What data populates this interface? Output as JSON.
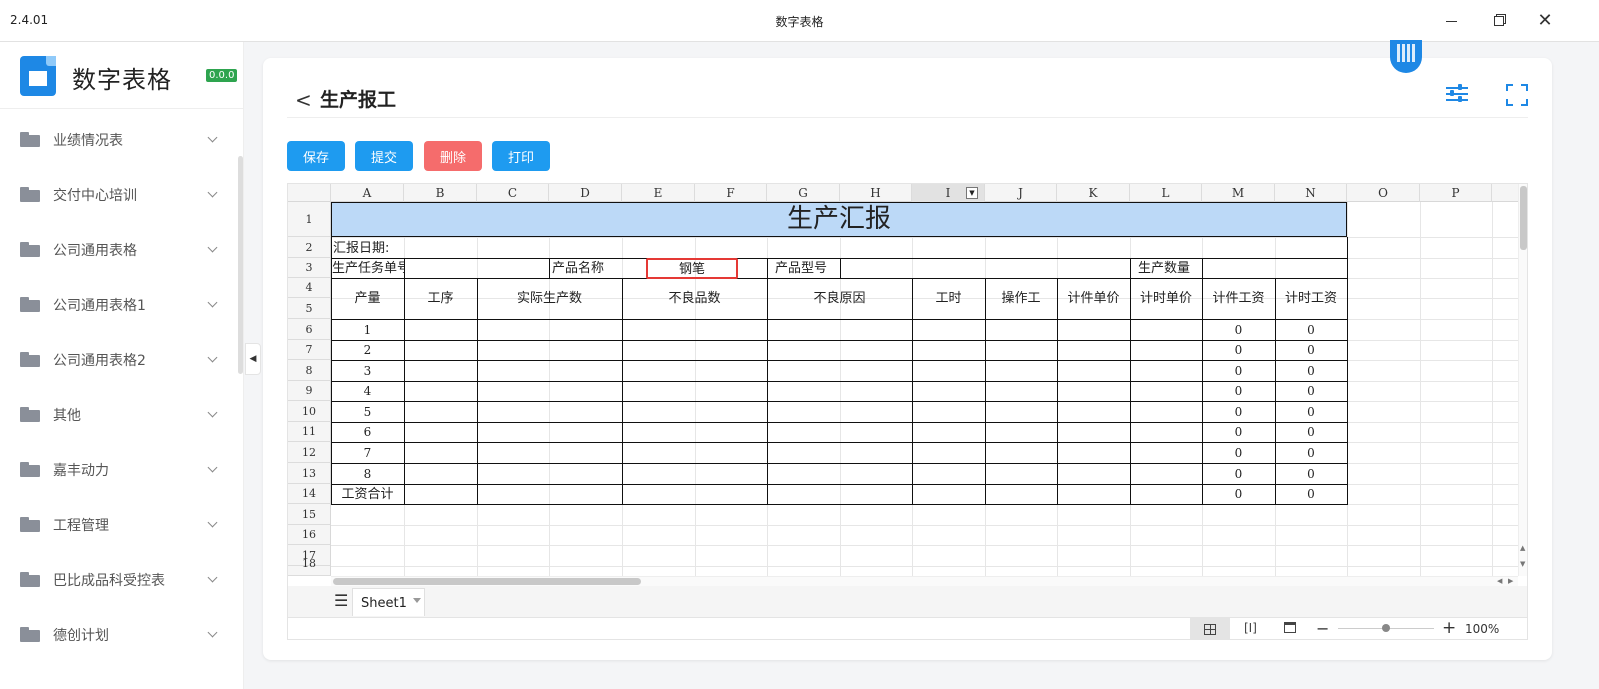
{
  "window": {
    "version": "2.4.01",
    "title": "数字表格"
  },
  "sidebar": {
    "app_name": "数字表格",
    "version_badge": "0.0.0",
    "items": [
      {
        "label": "业绩情况表"
      },
      {
        "label": "交付中心培训"
      },
      {
        "label": "公司通用表格"
      },
      {
        "label": "公司通用表格1"
      },
      {
        "label": "公司通用表格2"
      },
      {
        "label": "其他"
      },
      {
        "label": "嘉丰动力"
      },
      {
        "label": "工程管理"
      },
      {
        "label": "巴比成品科受控表"
      },
      {
        "label": "德创计划"
      }
    ]
  },
  "page": {
    "title": "生产报工",
    "back_symbol": "<"
  },
  "toolbar": {
    "save": "保存",
    "submit": "提交",
    "delete": "删除",
    "print": "打印",
    "colors": {
      "primary": "#1e9bf0",
      "danger": "#f56c6c"
    }
  },
  "spreadsheet": {
    "columns": [
      "A",
      "B",
      "C",
      "D",
      "E",
      "F",
      "G",
      "H",
      "I",
      "J",
      "K",
      "L",
      "M",
      "N",
      "O",
      "P"
    ],
    "rows": [
      "1",
      "2",
      "3",
      "4",
      "5",
      "6",
      "7",
      "8",
      "9",
      "10",
      "11",
      "12",
      "13",
      "14",
      "15",
      "16",
      "17",
      "18"
    ],
    "title": "生产汇报",
    "report_date_label": "汇报日期:",
    "task_no_label": "生产任务单号",
    "product_name_label": "产品名称",
    "product_name_value": "钢笔",
    "product_model_label": "产品型号",
    "production_qty_label": "生产数量",
    "headers": [
      "产量",
      "工序",
      "实际生产数",
      "不良品数",
      "不良原因",
      "工时",
      "操作工",
      "计件单价",
      "计时单价",
      "计件工资",
      "计时工资"
    ],
    "data_rows": [
      {
        "qty": "1",
        "piece_wage": "0",
        "time_wage": "0"
      },
      {
        "qty": "2",
        "piece_wage": "0",
        "time_wage": "0"
      },
      {
        "qty": "3",
        "piece_wage": "0",
        "time_wage": "0"
      },
      {
        "qty": "4",
        "piece_wage": "0",
        "time_wage": "0"
      },
      {
        "qty": "5",
        "piece_wage": "0",
        "time_wage": "0"
      },
      {
        "qty": "6",
        "piece_wage": "0",
        "time_wage": "0"
      },
      {
        "qty": "7",
        "piece_wage": "0",
        "time_wage": "0"
      },
      {
        "qty": "8",
        "piece_wage": "0",
        "time_wage": "0"
      }
    ],
    "total_row": {
      "label": "工资合计",
      "piece_wage": "0",
      "time_wage": "0"
    },
    "title_fill_color": "#bcd9f7",
    "highlight_color": "#e53935"
  },
  "sheet_tabs": {
    "menu_icon": "☰",
    "active": "Sheet1"
  },
  "statusbar": {
    "zoom": "100%",
    "minus": "−",
    "plus": "+"
  }
}
